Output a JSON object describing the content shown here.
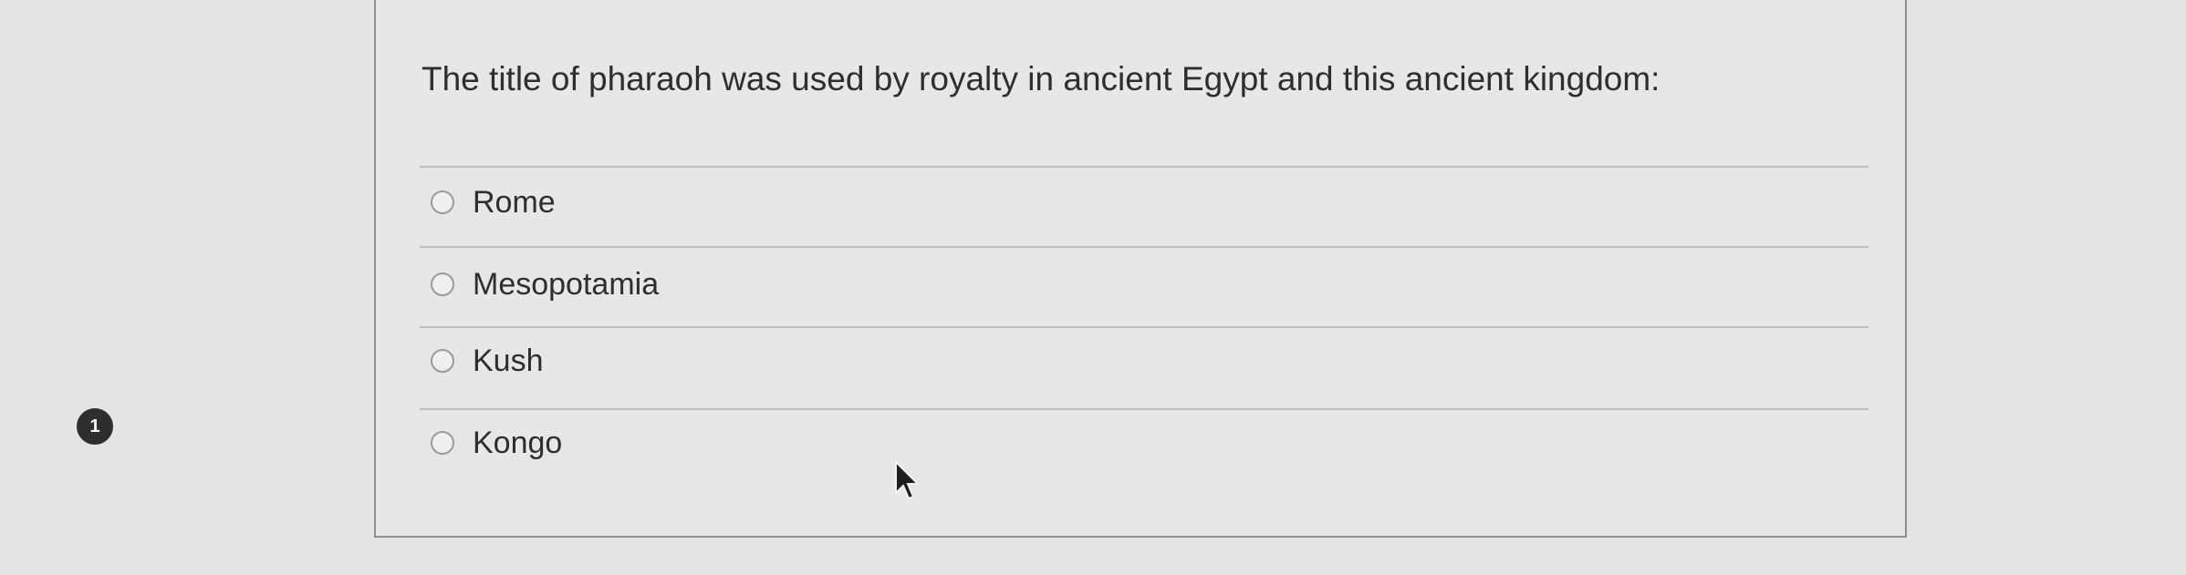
{
  "question": {
    "number": "1",
    "text": "The title of pharaoh was used by royalty in ancient Egypt and this ancient kingdom:",
    "options": [
      {
        "label": "Rome",
        "selected": false
      },
      {
        "label": "Mesopotamia",
        "selected": false
      },
      {
        "label": "Kush",
        "selected": false
      },
      {
        "label": "Kongo",
        "selected": false
      }
    ]
  },
  "icons": {
    "option_marker": "radio-button-icon",
    "pointer": "mouse-pointer-icon"
  },
  "colors": {
    "background": "#e4e4e2",
    "card_background": "#e7e7e5",
    "card_border": "#8f8f8d",
    "number_badge": "#2e2e2e",
    "text": "#2e2e2e"
  }
}
